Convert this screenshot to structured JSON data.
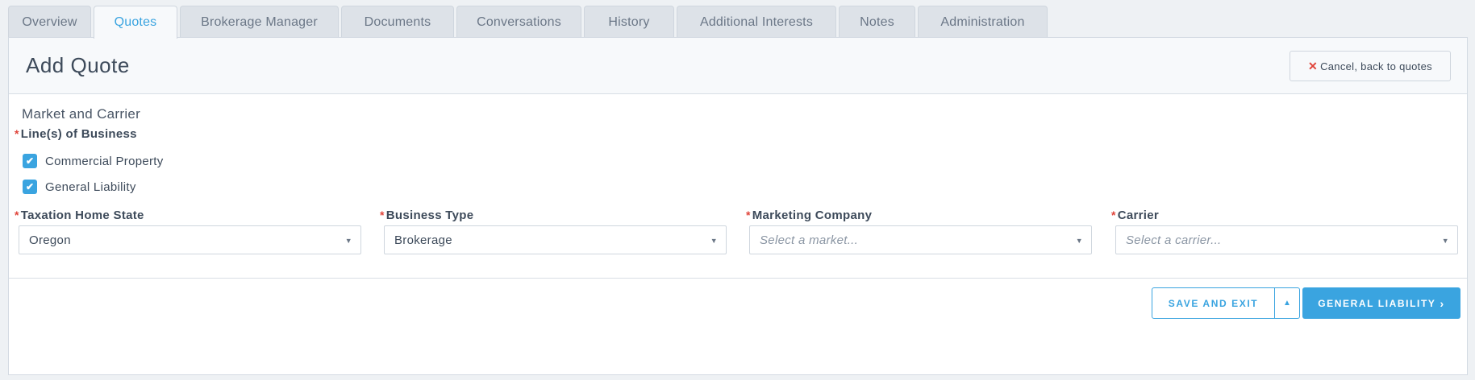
{
  "tabs": [
    {
      "label": "Overview",
      "active": false
    },
    {
      "label": "Quotes",
      "active": true
    },
    {
      "label": "Brokerage Manager",
      "active": false
    },
    {
      "label": "Documents",
      "active": false
    },
    {
      "label": "Conversations",
      "active": false
    },
    {
      "label": "History",
      "active": false
    },
    {
      "label": "Additional Interests",
      "active": false
    },
    {
      "label": "Notes",
      "active": false
    },
    {
      "label": "Administration",
      "active": false
    }
  ],
  "header": {
    "title": "Add Quote",
    "cancel_label": "Cancel, back to quotes",
    "cancel_icon": "close-icon"
  },
  "section": {
    "title": "Market and Carrier"
  },
  "lines_of_business": {
    "label": "Line(s) of Business",
    "required_mark": "*",
    "options": [
      {
        "label": "Commercial Property",
        "checked": true
      },
      {
        "label": "General Liability",
        "checked": true
      }
    ]
  },
  "fields": {
    "taxation_home_state": {
      "label": "Taxation Home State",
      "value": "Oregon",
      "placeholder": ""
    },
    "business_type": {
      "label": "Business Type",
      "value": "Brokerage",
      "placeholder": ""
    },
    "marketing_company": {
      "label": "Marketing Company",
      "value": "",
      "placeholder": "Select a market..."
    },
    "carrier": {
      "label": "Carrier",
      "value": "",
      "placeholder": "Select a carrier..."
    }
  },
  "footer": {
    "save_label": "SAVE AND EXIT",
    "next_label": "GENERAL LIABILITY"
  },
  "colors": {
    "accent": "#3aa4e0",
    "required": "#e0443a"
  }
}
